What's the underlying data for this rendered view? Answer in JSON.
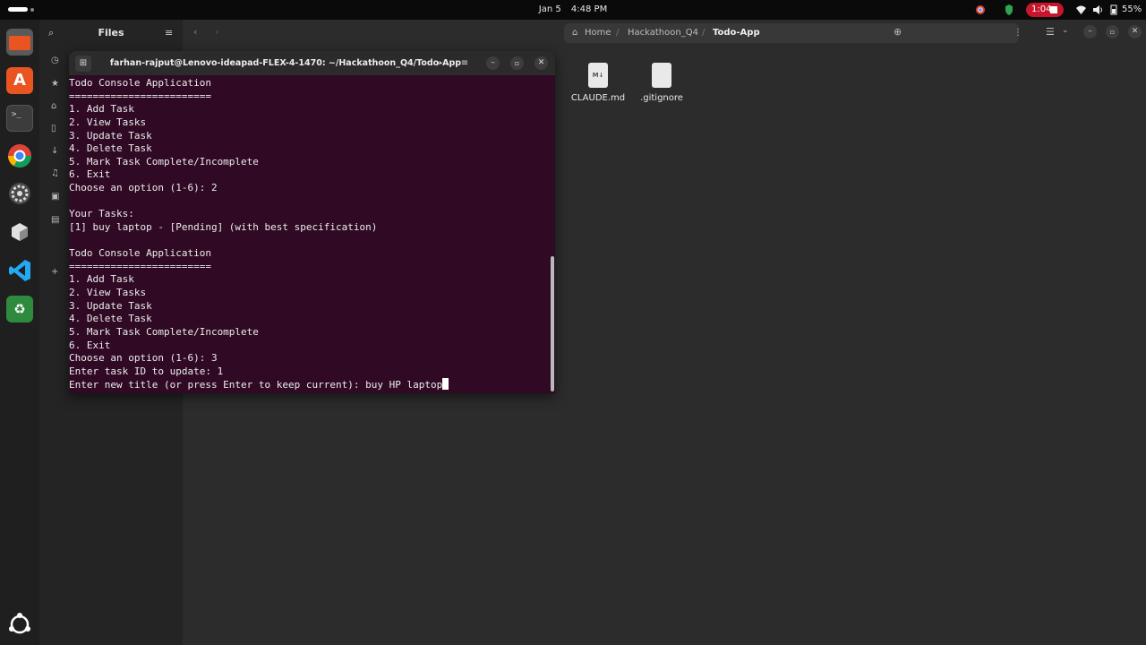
{
  "topbar": {
    "date": "Jan 5",
    "time": "4:48 PM",
    "recording_time": "1:04",
    "battery": "55%"
  },
  "dock": {
    "items": [
      "files-icon",
      "app-center-icon",
      "terminal-icon",
      "chrome-icon",
      "settings-icon",
      "app-icon",
      "vscode-icon",
      "trash-icon",
      "ubuntu-icon"
    ]
  },
  "files": {
    "title": "Files",
    "breadcrumb": [
      "Home",
      "Hackathoon_Q4",
      "Todo-App"
    ],
    "items": [
      {
        "name": "CLAUDE.md",
        "badge": "M↓"
      },
      {
        "name": ".gitignore",
        "badge": ""
      }
    ]
  },
  "terminal": {
    "title": "farhan-rajput@Lenovo-ideapad-FLEX-4-1470: ~/Hackathoon_Q4/Todo-App",
    "lines": [
      "Todo Console Application",
      "========================",
      "1. Add Task",
      "2. View Tasks",
      "3. Update Task",
      "4. Delete Task",
      "5. Mark Task Complete/Incomplete",
      "6. Exit",
      "Choose an option (1-6): 2",
      "",
      "Your Tasks:",
      "[1] buy laptop - [Pending] (with best specification)",
      "",
      "Todo Console Application",
      "========================",
      "1. Add Task",
      "2. View Tasks",
      "3. Update Task",
      "4. Delete Task",
      "5. Mark Task Complete/Incomplete",
      "6. Exit",
      "Choose an option (1-6): 3",
      "Enter task ID to update: 1",
      "Enter new title (or press Enter to keep current): buy HP laptop"
    ]
  }
}
